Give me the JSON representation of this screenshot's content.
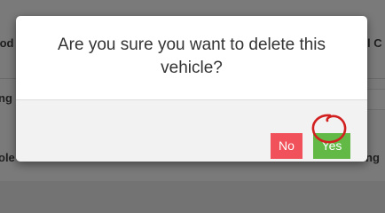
{
  "dialog": {
    "message": "Are you sure you want to delete this vehicle?",
    "no_label": "No",
    "yes_label": "Yes"
  },
  "background": {
    "left_label_1": "lod",
    "left_label_2": "ng",
    "left_label_3": "ole",
    "right_label_1": "l C",
    "right_label_2": "ng"
  },
  "colors": {
    "no_button": "#f0515a",
    "yes_button": "#62b946",
    "annotation_circle": "#d21f1f"
  }
}
